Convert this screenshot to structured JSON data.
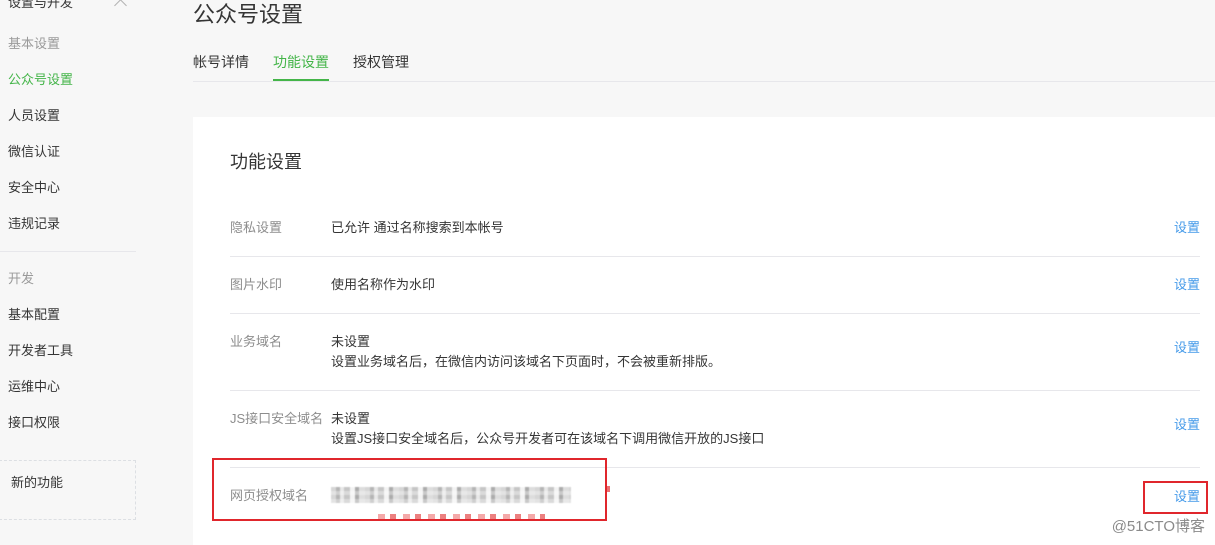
{
  "theme": {
    "accent": "#44b549",
    "link": "#459ae9",
    "annotation": "#e0262c",
    "text": "#353535",
    "muted": "#8d8d8d",
    "line": "#e7e7eb",
    "page-bg": "#f7f7f7"
  },
  "sidebar": {
    "group_title": "设置与开发",
    "group_icon": "chevron-up-icon",
    "sections": [
      {
        "title": "基本设置",
        "items": [
          {
            "label": "公众号设置",
            "active": true
          },
          {
            "label": "人员设置"
          },
          {
            "label": "微信认证"
          },
          {
            "label": "安全中心"
          },
          {
            "label": "违规记录"
          }
        ]
      },
      {
        "title": "开发",
        "items": [
          {
            "label": "基本配置"
          },
          {
            "label": "开发者工具"
          },
          {
            "label": "运维中心"
          },
          {
            "label": "接口权限"
          }
        ]
      }
    ],
    "new_features": "新的功能"
  },
  "page": {
    "title": "公众号设置",
    "tabs": [
      {
        "label": "帐号详情"
      },
      {
        "label": "功能设置",
        "active": true
      },
      {
        "label": "授权管理"
      }
    ]
  },
  "card": {
    "title": "功能设置",
    "rows": [
      {
        "label": "隐私设置",
        "lines": [
          "已允许 通过名称搜索到本帐号"
        ],
        "action": "设置"
      },
      {
        "label": "图片水印",
        "lines": [
          "使用名称作为水印"
        ],
        "action": "设置"
      },
      {
        "label": "业务域名",
        "lines": [
          "未设置",
          "设置业务域名后，在微信内访问该域名下页面时，不会被重新排版。"
        ],
        "action": "设置"
      },
      {
        "label": "JS接口安全域名",
        "lines": [
          "未设置",
          "设置JS接口安全域名后，公众号开发者可在该域名下调用微信开放的JS接口"
        ],
        "action": "设置"
      },
      {
        "label": "网页授权域名",
        "lines": [],
        "action": "设置"
      }
    ]
  },
  "watermark": "@51CTO博客"
}
